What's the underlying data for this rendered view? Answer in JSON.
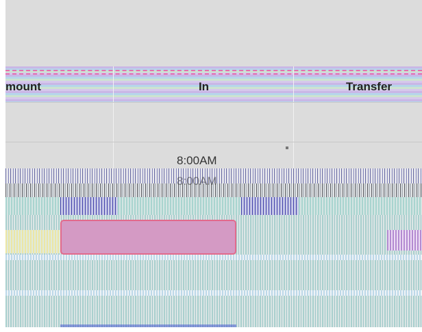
{
  "grid": {
    "columns": [
      {
        "label": "mount"
      },
      {
        "label": "In"
      },
      {
        "label": "Transfer"
      }
    ],
    "time_slots": [
      {
        "label": "8:00AM"
      },
      {
        "label": "8:00AM"
      }
    ]
  },
  "colors": {
    "background": "#dcdcdc",
    "header_band": "#c9b7e6",
    "header_dash": "#e46fae",
    "event_fill": "#d49ac4",
    "event_border": "#e26a8c",
    "stripe_teal": "#a9d0ce",
    "stripe_blue": "#3d3ca8"
  }
}
